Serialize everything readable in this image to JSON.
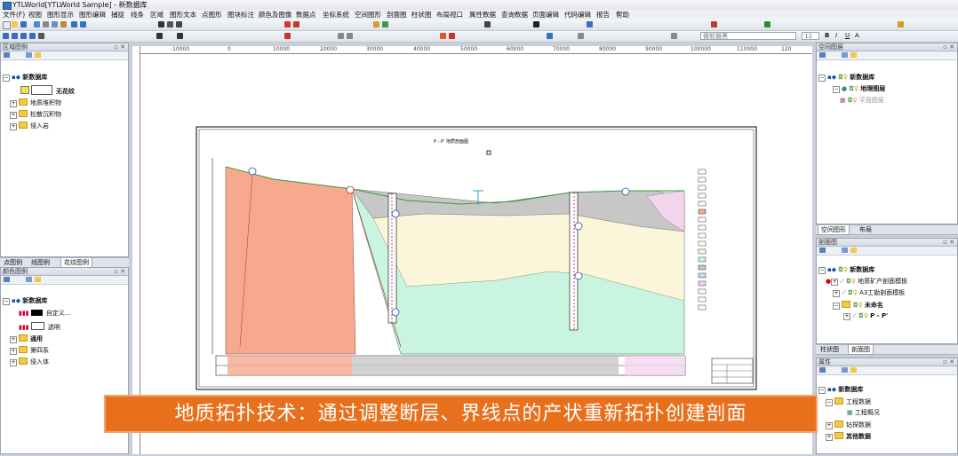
{
  "window": {
    "title": "YTLWorld[YTLWorld Sample] - 新数据库"
  },
  "menu": [
    "文件(F)",
    "视图",
    "图形显示",
    "图形编辑",
    "捕捉",
    "线条",
    "区域",
    "图形文本",
    "点图形",
    "图块标注",
    "颜色及图像",
    "数据点",
    "坐标系统",
    "空间图形",
    "剖面图",
    "柱状图",
    "布局视口",
    "属性数据",
    "查询数据",
    "页面编辑",
    "代码编辑",
    "报告",
    "帮助"
  ],
  "toolbar": {
    "font_combo": "微软雅黑",
    "size_combo": "12",
    "format_buttons": [
      "B",
      "I",
      "U",
      "A"
    ]
  },
  "ruler": {
    "labels": [
      "-10000",
      "0",
      "10000",
      "20000",
      "30000",
      "40000",
      "50000",
      "60000",
      "70000",
      "80000",
      "90000",
      "100000",
      "110000",
      "120"
    ]
  },
  "left_top_panel": {
    "title": "区域图例",
    "root": "新数据库",
    "items": [
      {
        "label": "无花纹"
      },
      {
        "label": "地质堆积物"
      },
      {
        "label": "松散沉积物"
      },
      {
        "label": "侵入岩"
      }
    ]
  },
  "left_tabs": [
    "点图例",
    "线图例",
    "花纹图例"
  ],
  "left_bottom_panel": {
    "title": "颜色图例",
    "root": "新数据库",
    "items": [
      {
        "label": "自定义..."
      },
      {
        "label": "透明"
      },
      {
        "label": "通用"
      },
      {
        "label": "第四系"
      },
      {
        "label": "侵入体"
      }
    ]
  },
  "right_top_panel": {
    "title": "空间图层",
    "root": "新数据库",
    "items": [
      {
        "label": "地理图层"
      },
      {
        "label": "平面图层"
      }
    ]
  },
  "right_tabs_1": [
    "空间图形",
    "布局"
  ],
  "right_mid_panel": {
    "title": "剖面图",
    "root": "新数据库",
    "items": [
      {
        "label": "地质矿产剖面模板"
      },
      {
        "label": "A3工勘剖面模板"
      },
      {
        "label": "未命名"
      },
      {
        "label": "P - P'"
      }
    ]
  },
  "right_tabs_2": [
    "柱状图",
    "剖面图"
  ],
  "right_bottom_panel": {
    "title": "属性",
    "root": "新数据库",
    "items": [
      {
        "label": "工程数据"
      },
      {
        "label": "工程概况"
      },
      {
        "label": "钻探数据"
      },
      {
        "label": "其他数据"
      }
    ]
  },
  "drawing": {
    "title": "P - P' 地质剖面图"
  },
  "caption": "地质拓扑技术：通过调整断层、界线点的产状重新拓扑创建剖面"
}
